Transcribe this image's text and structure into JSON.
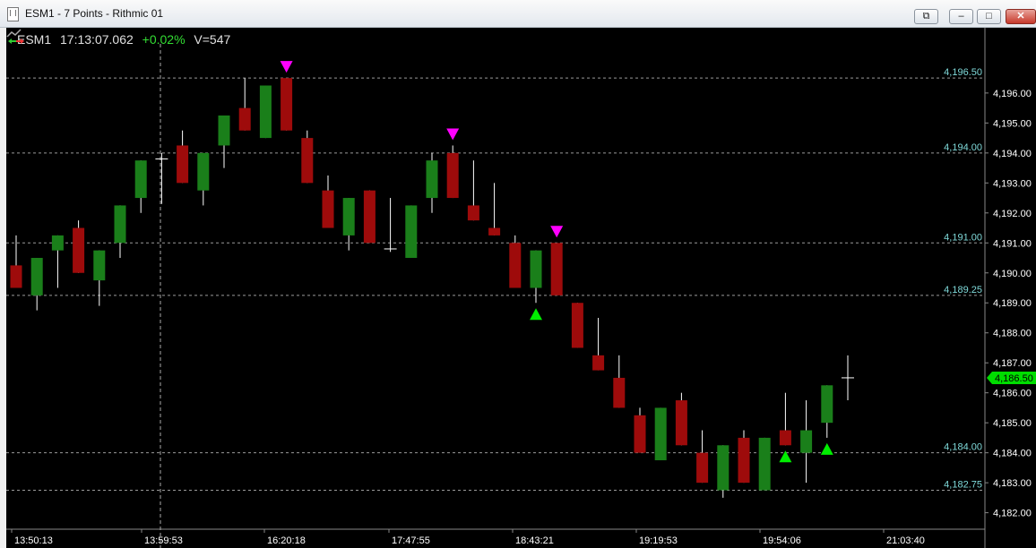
{
  "window": {
    "title": "ESM1 - 7 Points - Rithmic 01",
    "minimize_glyph": "–",
    "maximize_glyph": "□",
    "close_glyph": "✕",
    "restore_glyph": "⧉"
  },
  "header": {
    "instrument": "ESM1",
    "time": "17:13:07.062",
    "change": "+0.02%",
    "volume": "V=547"
  },
  "colors": {
    "background": "#000000",
    "up": "#1a7f1a",
    "down": "#9e0b0b",
    "wick": "#ffffff",
    "marker_down": "#ff00ff",
    "marker_up": "#00ee00",
    "level_label": "#7fd9d9",
    "axis_text": "#ffffff",
    "current_price_bg": "#00dd00"
  },
  "chart_data": {
    "type": "candlestick",
    "bar_period": "7 Points",
    "y_range": [
      4181.6,
      4197.4
    ],
    "y_ticks": [
      "4,196.00",
      "4,195.00",
      "4,194.00",
      "4,193.00",
      "4,192.00",
      "4,191.00",
      "4,190.00",
      "4,189.00",
      "4,188.00",
      "4,187.00",
      "4,186.00",
      "4,185.00",
      "4,184.00",
      "4,183.00",
      "4,182.00"
    ],
    "y_tick_values": [
      4196,
      4195,
      4194,
      4193,
      4192,
      4191,
      4190,
      4189,
      4188,
      4187,
      4186,
      4185,
      4184,
      4183,
      4182
    ],
    "x_labels": [
      "13:50:13",
      "13:59:53",
      "16:20:18",
      "17:47:55",
      "18:43:21",
      "19:19:53",
      "19:54:06",
      "21:03:40"
    ],
    "level_lines": [
      {
        "price": 4196.5,
        "label": "4,196.50"
      },
      {
        "price": 4194.0,
        "label": "4,194.00"
      },
      {
        "price": 4191.0,
        "label": "4,191.00"
      },
      {
        "price": 4189.25,
        "label": "4,189.25"
      },
      {
        "price": 4184.0,
        "label": "4,184.00"
      },
      {
        "price": 4182.75,
        "label": "4,182.75"
      }
    ],
    "current_price": {
      "price": 4186.5,
      "label": "4,186.50"
    },
    "candles": [
      {
        "o": 4190.25,
        "h": 4191.25,
        "l": 4189.5,
        "c": 4189.5
      },
      {
        "o": 4189.25,
        "h": 4190.5,
        "l": 4188.75,
        "c": 4190.5
      },
      {
        "o": 4190.75,
        "h": 4191.25,
        "l": 4189.5,
        "c": 4191.25
      },
      {
        "o": 4191.5,
        "h": 4191.75,
        "l": 4190.0,
        "c": 4190.0
      },
      {
        "o": 4189.75,
        "h": 4190.75,
        "l": 4188.9,
        "c": 4190.75
      },
      {
        "o": 4191.0,
        "h": 4192.25,
        "l": 4190.5,
        "c": 4192.25
      },
      {
        "o": 4192.5,
        "h": 4193.75,
        "l": 4192.0,
        "c": 4193.75
      },
      {
        "o": 4193.8,
        "h": 4194.0,
        "l": 4192.3,
        "c": 4193.8
      },
      {
        "o": 4194.25,
        "h": 4194.75,
        "l": 4193.0,
        "c": 4193.0
      },
      {
        "o": 4192.75,
        "h": 4194.0,
        "l": 4192.25,
        "c": 4194.0
      },
      {
        "o": 4194.25,
        "h": 4195.25,
        "l": 4193.5,
        "c": 4195.25
      },
      {
        "o": 4195.5,
        "h": 4196.5,
        "l": 4194.75,
        "c": 4194.75
      },
      {
        "o": 4194.5,
        "h": 4196.25,
        "l": 4194.5,
        "c": 4196.25
      },
      {
        "o": 4196.5,
        "h": 4196.5,
        "l": 4194.75,
        "c": 4194.75
      },
      {
        "o": 4194.5,
        "h": 4194.75,
        "l": 4193.0,
        "c": 4193.0
      },
      {
        "o": 4192.75,
        "h": 4193.25,
        "l": 4191.5,
        "c": 4191.5
      },
      {
        "o": 4191.25,
        "h": 4192.5,
        "l": 4190.75,
        "c": 4192.5
      },
      {
        "o": 4192.75,
        "h": 4192.75,
        "l": 4191.0,
        "c": 4191.0
      },
      {
        "o": 4190.8,
        "h": 4192.5,
        "l": 4190.7,
        "c": 4190.8
      },
      {
        "o": 4190.5,
        "h": 4192.25,
        "l": 4190.5,
        "c": 4192.25
      },
      {
        "o": 4192.5,
        "h": 4194.0,
        "l": 4192.0,
        "c": 4193.75
      },
      {
        "o": 4194.0,
        "h": 4194.25,
        "l": 4192.5,
        "c": 4192.5
      },
      {
        "o": 4192.25,
        "h": 4193.75,
        "l": 4191.75,
        "c": 4191.75
      },
      {
        "o": 4191.5,
        "h": 4193.0,
        "l": 4191.25,
        "c": 4191.25
      },
      {
        "o": 4191.0,
        "h": 4191.25,
        "l": 4189.5,
        "c": 4189.5
      },
      {
        "o": 4189.5,
        "h": 4190.75,
        "l": 4189.0,
        "c": 4190.75
      },
      {
        "o": 4191.0,
        "h": 4191.0,
        "l": 4189.25,
        "c": 4189.25
      },
      {
        "o": 4189.0,
        "h": 4189.0,
        "l": 4187.5,
        "c": 4187.5
      },
      {
        "o": 4187.25,
        "h": 4188.5,
        "l": 4186.75,
        "c": 4186.75
      },
      {
        "o": 4186.5,
        "h": 4187.25,
        "l": 4185.5,
        "c": 4185.5
      },
      {
        "o": 4185.25,
        "h": 4185.5,
        "l": 4184.0,
        "c": 4184.0
      },
      {
        "o": 4183.75,
        "h": 4185.5,
        "l": 4183.75,
        "c": 4185.5
      },
      {
        "o": 4185.75,
        "h": 4186.0,
        "l": 4184.25,
        "c": 4184.25
      },
      {
        "o": 4184.0,
        "h": 4184.75,
        "l": 4183.0,
        "c": 4183.0
      },
      {
        "o": 4182.75,
        "h": 4184.25,
        "l": 4182.5,
        "c": 4184.25
      },
      {
        "o": 4184.5,
        "h": 4184.75,
        "l": 4183.0,
        "c": 4183.0
      },
      {
        "o": 4182.75,
        "h": 4184.5,
        "l": 4182.75,
        "c": 4184.5
      },
      {
        "o": 4184.75,
        "h": 4186.0,
        "l": 4184.25,
        "c": 4184.25
      },
      {
        "o": 4184.0,
        "h": 4185.75,
        "l": 4183.0,
        "c": 4184.75
      },
      {
        "o": 4185.0,
        "h": 4186.25,
        "l": 4184.5,
        "c": 4186.25
      },
      {
        "o": 4186.5,
        "h": 4187.25,
        "l": 4185.75,
        "c": 4186.5
      }
    ],
    "markers": [
      {
        "index": 13,
        "dir": "down"
      },
      {
        "index": 21,
        "dir": "down"
      },
      {
        "index": 26,
        "dir": "down"
      },
      {
        "index": 25,
        "dir": "up"
      },
      {
        "index": 37,
        "dir": "up"
      },
      {
        "index": 39,
        "dir": "up"
      }
    ]
  }
}
